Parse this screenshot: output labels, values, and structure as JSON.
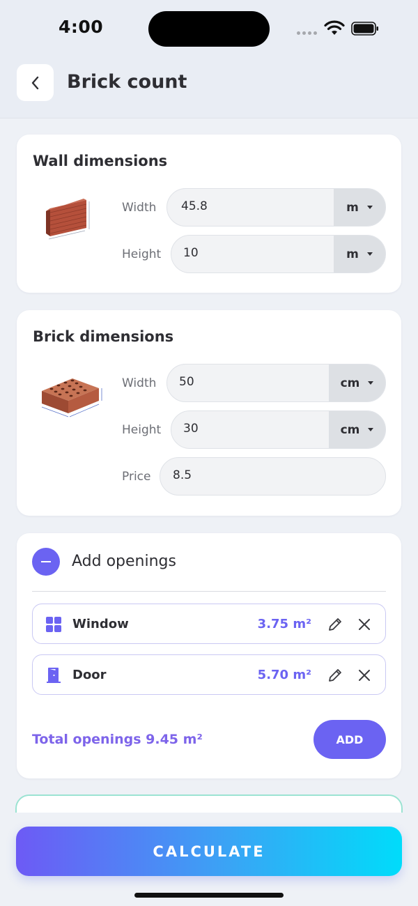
{
  "status_bar": {
    "time": "4:00"
  },
  "header": {
    "title": "Brick count",
    "back_icon": "chevron-left-icon"
  },
  "wall_card": {
    "title": "Wall dimensions",
    "width": {
      "label": "Width",
      "value": "45.8",
      "unit": "m"
    },
    "height": {
      "label": "Height",
      "value": "10",
      "unit": "m"
    }
  },
  "brick_card": {
    "title": "Brick dimensions",
    "width": {
      "label": "Width",
      "value": "50",
      "unit": "cm"
    },
    "height": {
      "label": "Height",
      "value": "30",
      "unit": "cm"
    },
    "price": {
      "label": "Price",
      "value": "8.5"
    }
  },
  "openings": {
    "title": "Add openings",
    "items": [
      {
        "name": "Window",
        "area": "3.75 m²",
        "icon": "window-icon"
      },
      {
        "name": "Door",
        "area": "5.70 m²",
        "icon": "door-icon"
      }
    ],
    "total": "Total openings 9.45 m²",
    "add_label": "ADD"
  },
  "calculate_label": "CALCULATE",
  "colors": {
    "accent": "#6b63f2",
    "gradient_start": "#6d5af5",
    "gradient_end": "#00dcfa"
  }
}
